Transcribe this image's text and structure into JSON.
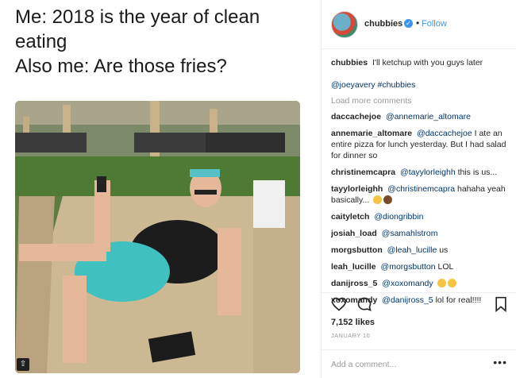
{
  "meme": {
    "lines": [
      "Me: 2018 is the year of clean",
      "eating",
      "Also me: Are those fries?"
    ]
  },
  "header": {
    "username": "chubbies",
    "separator": "•",
    "follow_label": "Follow"
  },
  "caption": {
    "username": "chubbies",
    "text": "I'll ketchup with you guys later",
    "tags": "@joeyavery #chubbies"
  },
  "load_more": "Load more comments",
  "comments": [
    {
      "user": "daccachejoe",
      "mention": "@annemarie_altomare",
      "text": ""
    },
    {
      "user": "annemarie_altomare",
      "mention": "@daccachejoe",
      "text": "I ate an entire pizza for lunch yesterday. But I had salad for dinner so"
    },
    {
      "user": "christinemcapra",
      "mention": "@tayylorleighh",
      "text": "this is us..."
    },
    {
      "user": "tayylorleighh",
      "mention": "@christinemcapra",
      "text": "hahaha yeah basically..."
    },
    {
      "user": "caityletch",
      "mention": "@diongribbin",
      "text": ""
    },
    {
      "user": "josiah_load",
      "mention": "@samahlstrom",
      "text": ""
    },
    {
      "user": "morgsbutton",
      "mention": "@leah_lucille",
      "text": "us"
    },
    {
      "user": "leah_lucille",
      "mention": "@morgsbutton",
      "text": "LOL"
    },
    {
      "user": "danijross_5",
      "mention": "@xoxomandy",
      "text": ""
    },
    {
      "user": "xoxomandy",
      "mention": "@danijross_5",
      "text": "lol for real!!!!"
    }
  ],
  "likes": "7,152 likes",
  "date": "JANUARY 10",
  "add_comment_placeholder": "Add a comment...",
  "more_options": "•••",
  "photo_badge": "⇧",
  "icons": {
    "like": "heart-icon",
    "comment": "comment-icon",
    "save": "bookmark-icon"
  },
  "colors": {
    "link": "#3897f0",
    "mention": "#003569",
    "muted": "#999999"
  }
}
